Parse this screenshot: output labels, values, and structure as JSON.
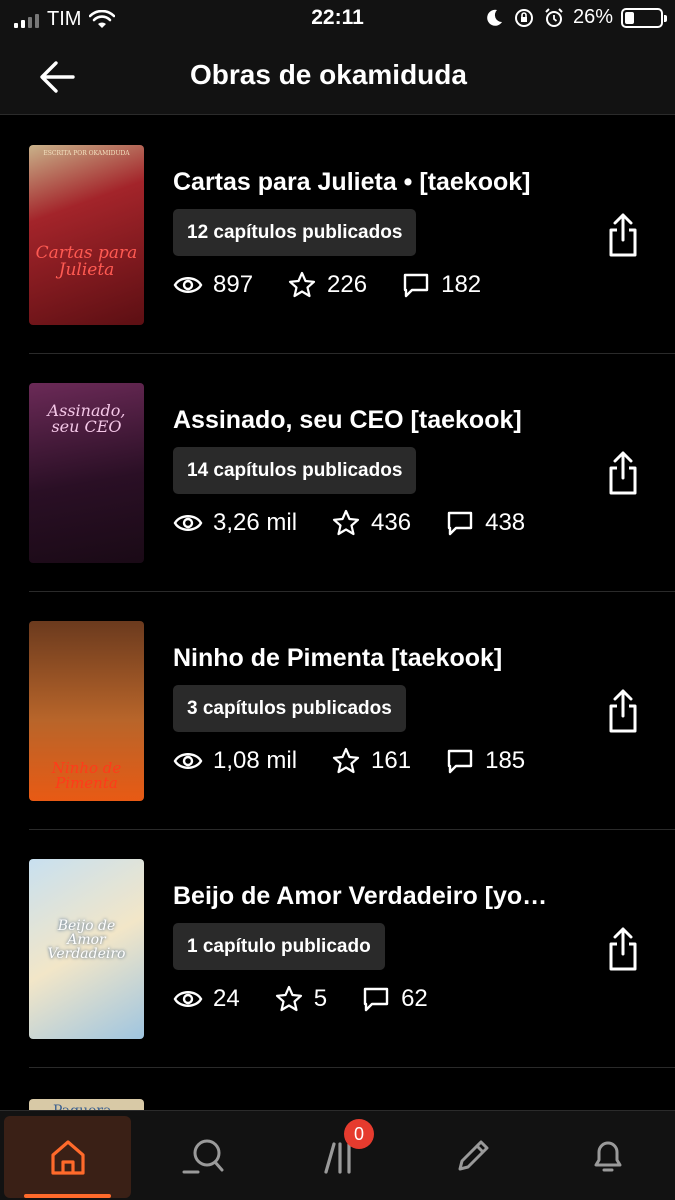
{
  "status_bar": {
    "carrier": "TIM",
    "time": "22:11",
    "battery_percent": "26%",
    "battery_level": 0.26
  },
  "header": {
    "title": "Obras de okamiduda",
    "back_icon": "arrow-left-icon"
  },
  "stories": [
    {
      "title": "Cartas para Julieta • [taekook]",
      "chapters": "12 capítulos publicados",
      "reads": "897",
      "votes": "226",
      "comments": "182",
      "cover": {
        "colors": [
          "#5c0f13",
          "#a3242a",
          "#c9b28a"
        ],
        "top_text": "ESCRITA POR OKAMIDUDA",
        "main_text": "Cartas para Julieta"
      }
    },
    {
      "title": "Assinado, seu CEO [taekook]",
      "chapters": "14 capítulos publicados",
      "reads": "3,26 mil",
      "votes": "436",
      "comments": "438",
      "cover": {
        "colors": [
          "#2a0f25",
          "#6b2a57",
          "#1a0a16"
        ],
        "main_text": "Assinado, seu CEO"
      }
    },
    {
      "title": "Ninho de Pimenta [taekook]",
      "chapters": "3 capítulos publicados",
      "reads": "1,08 mil",
      "votes": "161",
      "comments": "185",
      "cover": {
        "colors": [
          "#6b3a1e",
          "#b8652a",
          "#e85a14"
        ],
        "main_text": "Ninho de Pimenta"
      }
    },
    {
      "title": "Beijo de Amor Verdadeiro [yo…",
      "chapters": "1 capítulo publicado",
      "reads": "24",
      "votes": "5",
      "comments": "62",
      "cover": {
        "colors": [
          "#9fc5e0",
          "#f2e6c8",
          "#c8e0f0"
        ],
        "main_text": "Beijo de Amor Verdadeiro"
      }
    }
  ],
  "partial_cover_text": "Paquera",
  "bottom_nav": [
    {
      "name": "home",
      "icon": "home-icon",
      "active": true
    },
    {
      "name": "search",
      "icon": "search-icon",
      "active": false
    },
    {
      "name": "library",
      "icon": "library-icon",
      "active": false,
      "badge": "0"
    },
    {
      "name": "write",
      "icon": "pencil-icon",
      "active": false
    },
    {
      "name": "notifications",
      "icon": "bell-icon",
      "active": false
    }
  ],
  "colors": {
    "accent": "#ff6a2b",
    "background": "#000000",
    "surface": "#121212",
    "badge_bg": "#2a2a2a",
    "notification_badge": "#e63b2e"
  }
}
